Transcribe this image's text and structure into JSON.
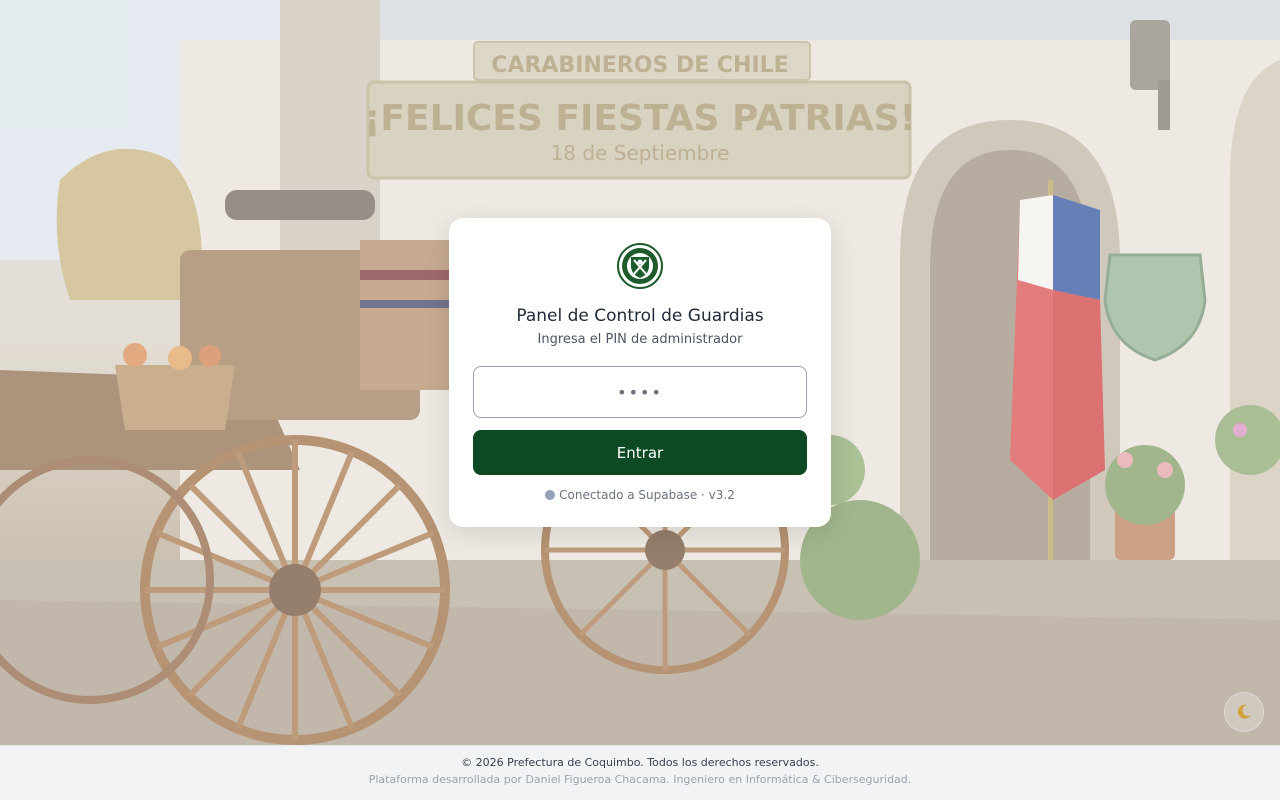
{
  "login": {
    "title": "Panel de Control de Guardias",
    "subtitle": "Ingresa el PIN de administrador",
    "pin_placeholder": "••••",
    "submit_label": "Entrar",
    "status_text": "Conectado a Supabase · v3.2"
  },
  "footer": {
    "copyright": "© 2026 Prefectura de Coquimbo. Todos los derechos reservados.",
    "credits": "Plataforma desarrollada por Daniel Figueroa Chacama. Ingeniero en Informática & Ciberseguridad."
  },
  "background": {
    "sign_org": "CARABINEROS DE CHILE",
    "sign_greeting": "¡FELICES FIESTAS PATRIAS!",
    "sign_date": "18 de Septiembre"
  },
  "colors": {
    "primary_button": "#0b4a22",
    "status_dot": "#94a3b8"
  },
  "icons": {
    "logo": "carabineros-emblem",
    "theme_toggle": "moon-icon"
  }
}
